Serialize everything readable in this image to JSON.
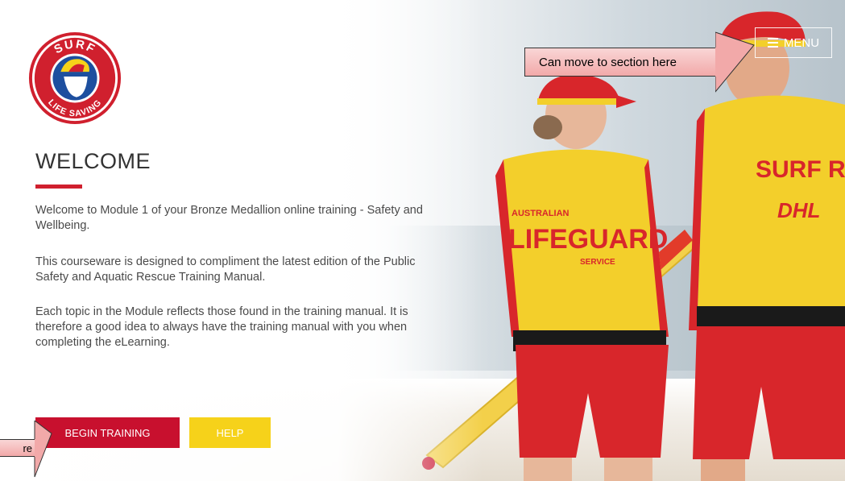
{
  "logo": {
    "top_text": "SURF",
    "bottom_text": "LIFE SAVING",
    "colors": {
      "ring": "#d0202e",
      "inner": "#1d4f9f",
      "cap": "#f6d21a"
    }
  },
  "welcome": {
    "title": "WELCOME",
    "paragraphs": [
      "Welcome to Module 1 of your Bronze Medallion online training - Safety and Wellbeing.",
      "This courseware is designed to compliment the latest edition of the Public Safety and Aquatic Rescue Training Manual.",
      "Each topic in the Module reflects those found in the training manual. It is therefore a good idea to always have the training manual with you when completing the eLearning."
    ]
  },
  "buttons": {
    "begin_training": "BEGIN TRAINING",
    "help": "HELP"
  },
  "menu": {
    "label": "MENU",
    "icon": "hamburger-icon"
  },
  "annotations": {
    "menu_callout": "Can move to section here",
    "begin_callout": "re"
  },
  "photo": {
    "left_shirt_line1": "AUSTRALIAN",
    "left_shirt_line2": "LIFEGUARD",
    "left_shirt_line3": "SERVICE",
    "right_shirt": "SURF RESCU",
    "right_sponsor": "DHL"
  },
  "colors": {
    "accent_red": "#c8102e",
    "help_yellow": "#f6d21a",
    "callout_pink": "#f2a9a9",
    "shirt_yellow": "#f3cf2b",
    "shorts_red": "#d8262b"
  }
}
